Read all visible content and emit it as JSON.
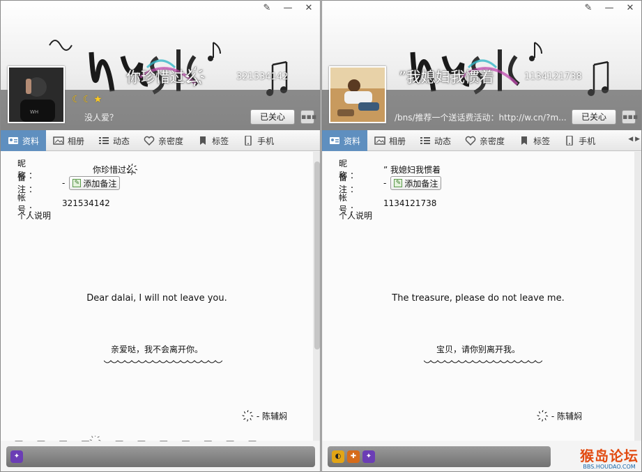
{
  "left": {
    "nickname": "你珍惜过么҉",
    "qq": "321534142",
    "signature": "没人爱？",
    "followed_label": "已关心",
    "tabs": [
      "资料",
      "相册",
      "动态",
      "亲密度",
      "标签",
      "手机"
    ],
    "fields": {
      "nick_label": "昵　称：",
      "nick_value": "你珍惜过么҉",
      "note_label": "备　注：",
      "note_value": "-",
      "add_note": "添加备注",
      "acct_label": "帐　号：",
      "acct_value": "321534142",
      "intro_label": "个人说明"
    },
    "desc_en": "Dear  dalai, I will not leave you.",
    "desc_cn": "亲爱哒，我不会离开你。",
    "author": "҉ - 陈辅焖"
  },
  "right": {
    "nickname": "”我媳妇我惯着",
    "qq": "1134121738",
    "signature": "/bns/推荐一个送话费活动：http://w.cn/?m...",
    "followed_label": "已关心",
    "tabs": [
      "资料",
      "相册",
      "动态",
      "亲密度",
      "标签",
      "手机"
    ],
    "fields": {
      "nick_label": "昵　称：",
      "nick_value": "” 我媳妇我惯着",
      "note_label": "备　注：",
      "note_value": "-",
      "add_note": "添加备注",
      "acct_label": "帐　号：",
      "acct_value": "1134121738",
      "intro_label": "个人说明"
    },
    "desc_en": "The treasure, please do not leave me.",
    "desc_cn": "宝贝，请你别离开我。",
    "author": "҉ - 陈辅焖"
  },
  "watermark": {
    "main": "猴岛论坛",
    "sub": "BBS.HOUDAO.COM"
  },
  "colors": {
    "active_tab": "#5f8fbf",
    "moon": "#ffcc22",
    "watermark": "#e24a10"
  }
}
